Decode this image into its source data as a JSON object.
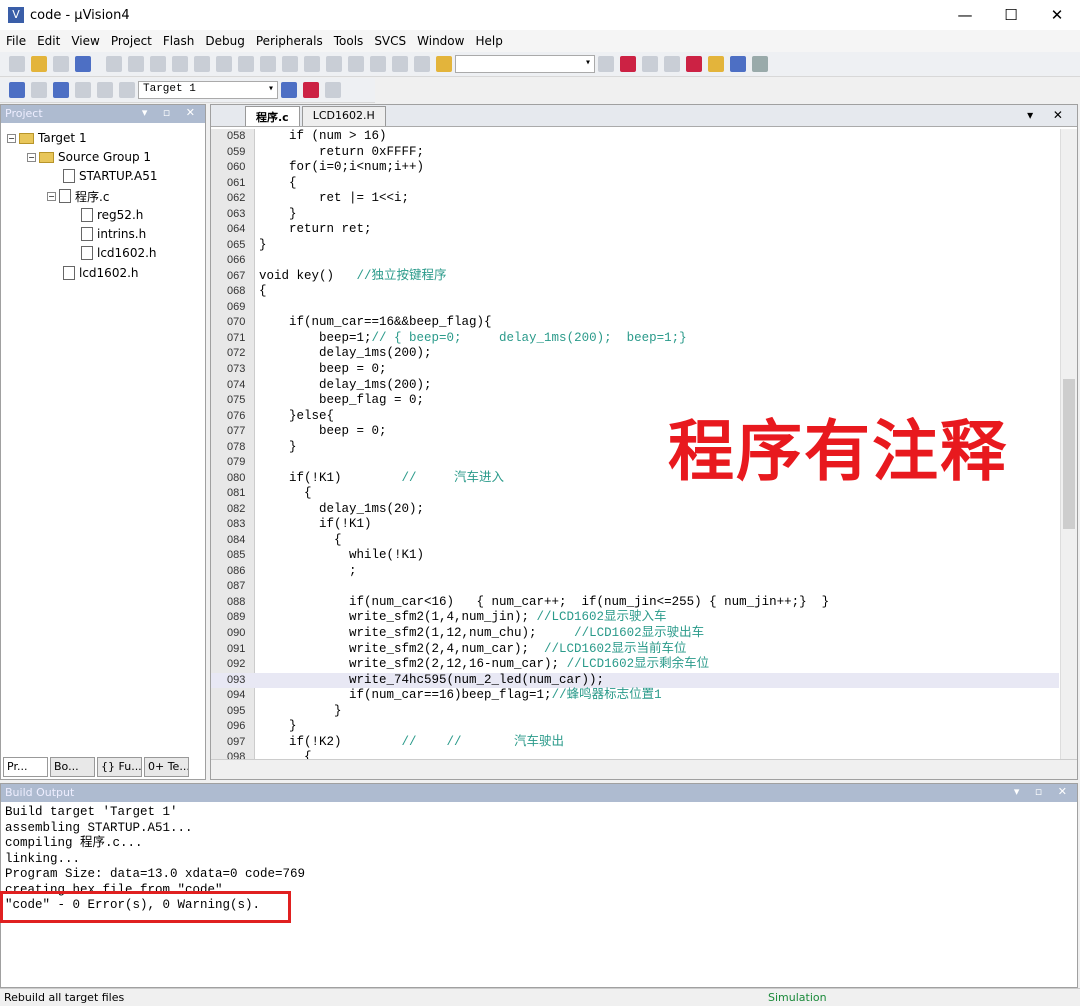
{
  "window": {
    "title": "code - µVision4",
    "minimize": "—",
    "maximize": "☐",
    "close": "✕"
  },
  "menu": [
    "File",
    "Edit",
    "View",
    "Project",
    "Flash",
    "Debug",
    "Peripherals",
    "Tools",
    "SVCS",
    "Window",
    "Help"
  ],
  "toolbar": {
    "target_select": "Target 1"
  },
  "project_panel": {
    "title": "Project",
    "tree": [
      "Target 1",
      "Source Group 1",
      "STARTUP.A51",
      "程序.c",
      "reg52.h",
      "intrins.h",
      "lcd1602.h",
      "lcd1602.h"
    ],
    "tabs": [
      "Pr...",
      "Bo...",
      "{} Fu...",
      "0+ Te..."
    ]
  },
  "editor": {
    "tabs": [
      "程序.c",
      "LCD1602.H"
    ],
    "lines": [
      [
        "058",
        "    if (num > 16)",
        ""
      ],
      [
        "059",
        "        return 0xFFFF;",
        ""
      ],
      [
        "060",
        "    for(i=0;i<num;i++)",
        ""
      ],
      [
        "061",
        "    {",
        ""
      ],
      [
        "062",
        "        ret |= 1<<i;",
        ""
      ],
      [
        "063",
        "    }",
        ""
      ],
      [
        "064",
        "    return ret;",
        ""
      ],
      [
        "065",
        "}",
        ""
      ],
      [
        "066",
        "",
        ""
      ],
      [
        "067",
        "void key()   ",
        "//独立按键程序"
      ],
      [
        "068",
        "{",
        ""
      ],
      [
        "069",
        "",
        ""
      ],
      [
        "070",
        "    if(num_car==16&&beep_flag){",
        ""
      ],
      [
        "071",
        "        beep=1;",
        "// { beep=0;     delay_1ms(200);  beep=1;}"
      ],
      [
        "072",
        "        delay_1ms(200);",
        ""
      ],
      [
        "073",
        "        beep = 0;",
        ""
      ],
      [
        "074",
        "        delay_1ms(200);",
        ""
      ],
      [
        "075",
        "        beep_flag = 0;",
        ""
      ],
      [
        "076",
        "    }else{",
        ""
      ],
      [
        "077",
        "        beep = 0;",
        ""
      ],
      [
        "078",
        "    }",
        ""
      ],
      [
        "079",
        "",
        ""
      ],
      [
        "080",
        "    if(!K1)        ",
        "//     汽车进入"
      ],
      [
        "081",
        "      {",
        ""
      ],
      [
        "082",
        "        delay_1ms(20);",
        ""
      ],
      [
        "083",
        "        if(!K1)",
        ""
      ],
      [
        "084",
        "          {",
        ""
      ],
      [
        "085",
        "            while(!K1)",
        ""
      ],
      [
        "086",
        "            ;",
        ""
      ],
      [
        "087",
        "",
        ""
      ],
      [
        "088",
        "            if(num_car<16)   { num_car++;  if(num_jin<=255) { num_jin++;}  }",
        ""
      ],
      [
        "089",
        "            write_sfm2(1,4,num_jin); ",
        "//LCD1602显示驶入车"
      ],
      [
        "090",
        "            write_sfm2(1,12,num_chu);     ",
        "//LCD1602显示驶出车"
      ],
      [
        "091",
        "            write_sfm2(2,4,num_car);  ",
        "//LCD1602显示当前车位"
      ],
      [
        "092",
        "            write_sfm2(2,12,16-num_car); ",
        "//LCD1602显示剩余车位"
      ],
      [
        "093",
        "            write_74hc595(num_2_led(num_car));",
        ""
      ],
      [
        "094",
        "            if(num_car==16)beep_flag=1;",
        "//蜂鸣器标志位置1"
      ],
      [
        "095",
        "          }",
        ""
      ],
      [
        "096",
        "    }",
        ""
      ],
      [
        "097",
        "    if(!K2)        ",
        "//    //       汽车驶出"
      ],
      [
        "098",
        "      {",
        ""
      ]
    ]
  },
  "overlay_text": "程序有注释",
  "build_output": {
    "title": "Build Output",
    "lines": [
      "Build target 'Target 1'",
      "assembling STARTUP.A51...",
      "compiling 程序.c...",
      "linking...",
      "Program Size: data=13.0 xdata=0 code=769",
      "creating hex file from \"code\"...",
      "\"code\" - 0 Error(s), 0 Warning(s)."
    ]
  },
  "status": {
    "left": "Rebuild all target files",
    "mode": "Simulation"
  }
}
